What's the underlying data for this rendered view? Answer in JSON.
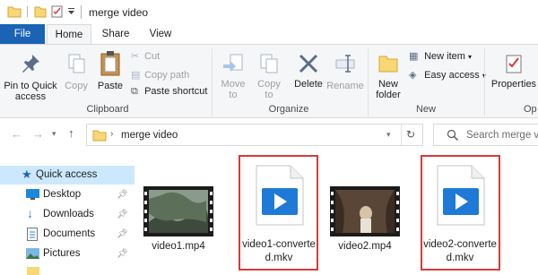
{
  "window": {
    "title": "merge video"
  },
  "tabs": [
    {
      "label": "File"
    },
    {
      "label": "Home"
    },
    {
      "label": "Share"
    },
    {
      "label": "View"
    }
  ],
  "ribbon": {
    "clipboard": {
      "pin": "Pin to Quick access",
      "copy": "Copy",
      "paste": "Paste",
      "cut": "Cut",
      "copy_path": "Copy path",
      "paste_shortcut": "Paste shortcut",
      "label": "Clipboard"
    },
    "organize": {
      "move_to": "Move to",
      "copy_to": "Copy to",
      "delete": "Delete",
      "rename": "Rename",
      "label": "Organize"
    },
    "new": {
      "new_folder": "New folder",
      "new_item": "New item",
      "easy_access": "Easy access",
      "label": "New"
    },
    "open": {
      "properties": "Properties",
      "label": "Op"
    }
  },
  "address": {
    "path": "merge video",
    "search_placeholder": "Search merge video"
  },
  "nav": [
    {
      "label": "Quick access",
      "icon": "star-icon",
      "selected": true
    },
    {
      "label": "Desktop",
      "icon": "desktop-icon",
      "pinned": true
    },
    {
      "label": "Downloads",
      "icon": "download-icon",
      "pinned": true
    },
    {
      "label": "Documents",
      "icon": "documents-icon",
      "pinned": true
    },
    {
      "label": "Pictures",
      "icon": "pictures-icon",
      "pinned": true
    }
  ],
  "files": [
    {
      "name": "video1.mp4",
      "type": "video-thumbnail"
    },
    {
      "name": "video1-converted.mkv",
      "line1": "video1-converte",
      "line2": "d.mkv",
      "type": "mkv",
      "highlighted": true
    },
    {
      "name": "video2.mp4",
      "type": "video-thumbnail"
    },
    {
      "name": "video2-converted.mkv",
      "line1": "video2-converte",
      "line2": "d.mkv",
      "type": "mkv",
      "highlighted": true
    }
  ],
  "colors": {
    "accent": "#1a63b5",
    "highlight": "#d63a3a",
    "selection": "#cce8ff"
  }
}
